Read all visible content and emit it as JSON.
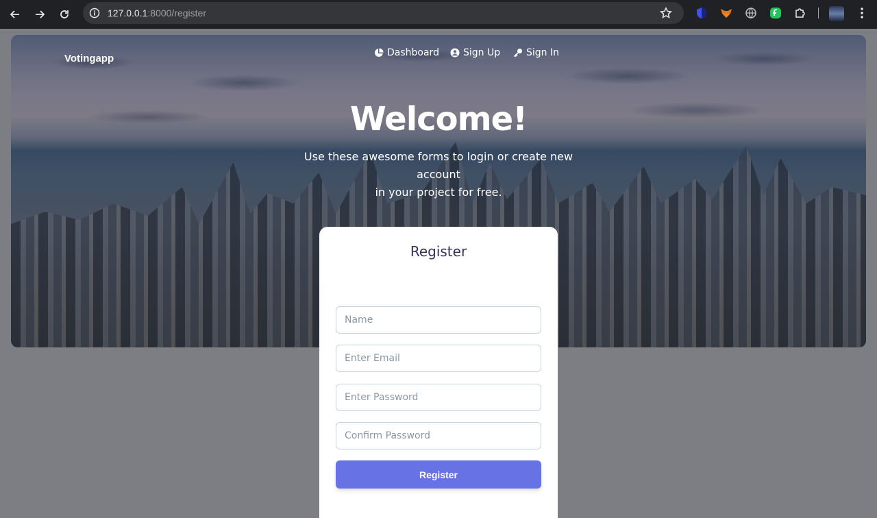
{
  "browser": {
    "url_host": "127.0.0.1",
    "url_path": ":8000/register"
  },
  "navbar": {
    "brand": "Votingapp",
    "links": [
      {
        "label": "Dashboard",
        "icon": "pie-chart-icon"
      },
      {
        "label": "Sign Up",
        "icon": "user-circle-icon"
      },
      {
        "label": "Sign In",
        "icon": "key-icon"
      }
    ]
  },
  "hero": {
    "title": "Welcome!",
    "subtitle_line1": "Use these awesome forms to login or create new account",
    "subtitle_line2": "in your project for free."
  },
  "form": {
    "title": "Register",
    "fields": [
      {
        "placeholder": "Name"
      },
      {
        "placeholder": "Enter Email"
      },
      {
        "placeholder": "Enter Password"
      },
      {
        "placeholder": "Confirm Password"
      }
    ],
    "submit_label": "Register"
  },
  "colors": {
    "accent": "#6772e5",
    "heading": "#32325d",
    "placeholder": "#8898aa"
  }
}
